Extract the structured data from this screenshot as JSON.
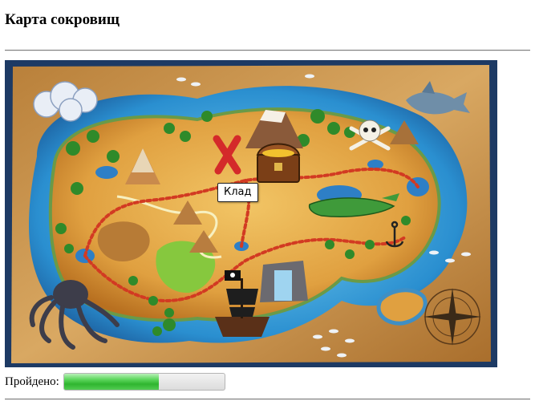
{
  "page": {
    "title": "Карта сокровищ"
  },
  "map": {
    "tooltip": "Клад"
  },
  "progress": {
    "label": "Пройдено:",
    "value": 0.59
  },
  "colors": {
    "parchment": "#c9944b",
    "sea": "#2a8fd0",
    "land": "#e3a542",
    "path": "#d23a22",
    "progress_fill": "#3cbf3c",
    "border_dark": "#1d3a64"
  }
}
